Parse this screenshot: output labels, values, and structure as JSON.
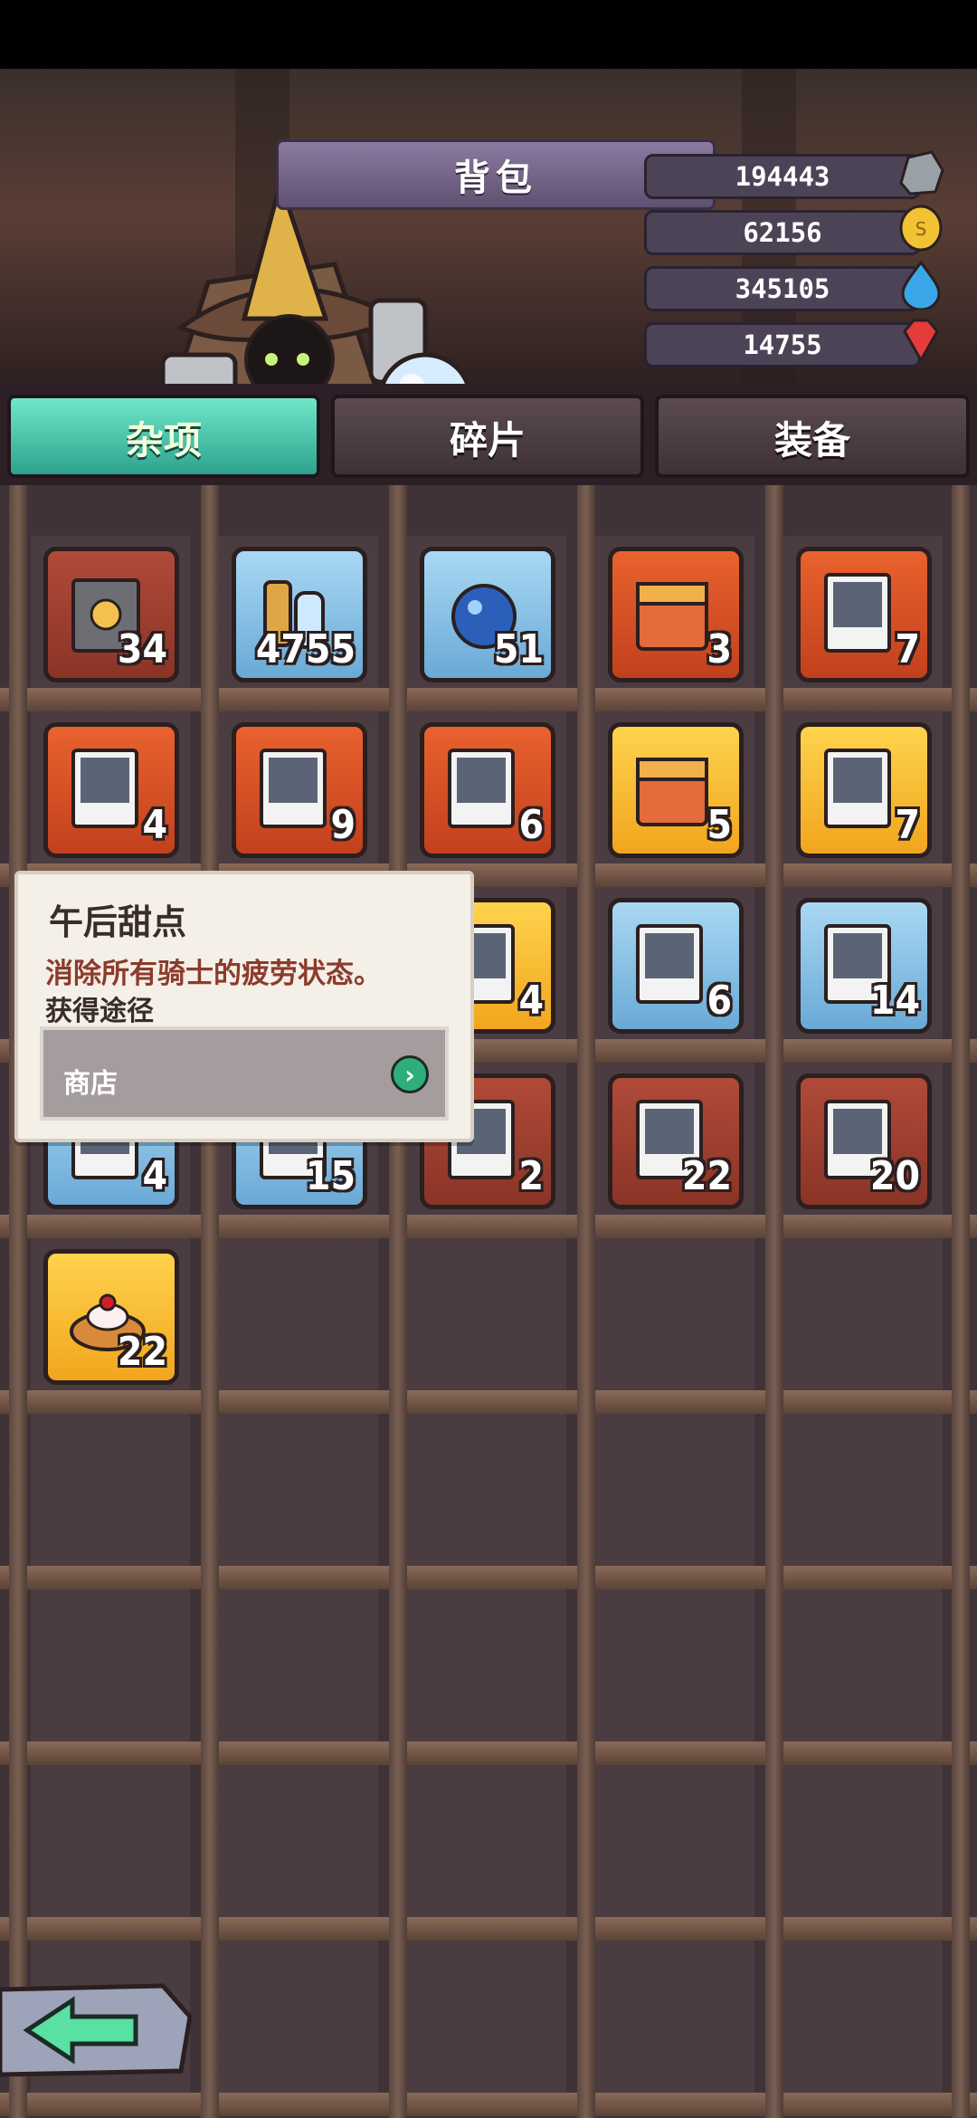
{
  "header": {
    "title": "背包"
  },
  "currencies": [
    {
      "value": "194443",
      "icon": "ore-icon"
    },
    {
      "value": "62156",
      "icon": "gold-coin-icon"
    },
    {
      "value": "345105",
      "icon": "water-drop-icon"
    },
    {
      "value": "14755",
      "icon": "red-gem-icon"
    }
  ],
  "tabs": [
    {
      "label": "杂项",
      "active": true
    },
    {
      "label": "碎片",
      "active": false
    },
    {
      "label": "装备",
      "active": false
    }
  ],
  "items": [
    {
      "name": "gear-book",
      "count": "34",
      "rarity": "brown"
    },
    {
      "name": "brush-and-potion",
      "count": "4755",
      "rarity": "blue"
    },
    {
      "name": "blue-orb",
      "count": "51",
      "rarity": "blue"
    },
    {
      "name": "red-chest",
      "count": "3",
      "rarity": "red"
    },
    {
      "name": "rifle-card",
      "count": "7",
      "rarity": "red"
    },
    {
      "name": "armor-card",
      "count": "4",
      "rarity": "red"
    },
    {
      "name": "hat-card",
      "count": "9",
      "rarity": "red"
    },
    {
      "name": "potion-card",
      "count": "6",
      "rarity": "red"
    },
    {
      "name": "silver-chest",
      "count": "5",
      "rarity": "gold"
    },
    {
      "name": "rifle-card",
      "count": "7",
      "rarity": "gold"
    },
    {
      "name": "potion-card",
      "count": "4",
      "rarity": "gold"
    },
    {
      "name": "rifle-card",
      "count": "6",
      "rarity": "blue"
    },
    {
      "name": "armor-card",
      "count": "14",
      "rarity": "blue"
    },
    {
      "name": "hat-card",
      "count": "4",
      "rarity": "blue"
    },
    {
      "name": "potion-card",
      "count": "15",
      "rarity": "blue"
    },
    {
      "name": "rifle-card",
      "count": "2",
      "rarity": "brown"
    },
    {
      "name": "armor-card",
      "count": "22",
      "rarity": "brown"
    },
    {
      "name": "potion-card",
      "count": "20",
      "rarity": "brown"
    },
    {
      "name": "cherry-pie",
      "count": "22",
      "rarity": "gold"
    }
  ],
  "tooltip": {
    "title": "午后甜点",
    "description": "消除所有骑士的疲劳状态。",
    "source_heading": "获得途径",
    "source": "商店"
  },
  "colors": {
    "tab_active": "#2fa28e",
    "currency_bar": "#4d4357",
    "tooltip_desc": "#8c3b2c"
  }
}
